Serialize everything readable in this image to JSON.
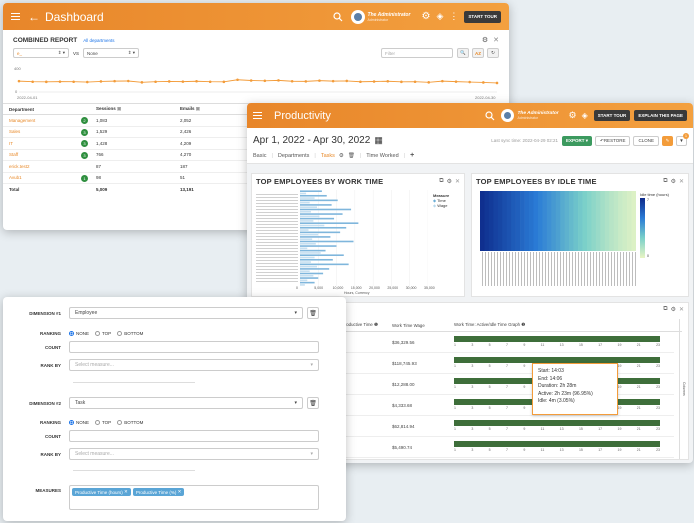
{
  "dashboard": {
    "title": "Dashboard",
    "start_tour": "START TOUR",
    "user_name": "The Administrator",
    "user_sub": "Administrator",
    "report_title": "COMBINED REPORT",
    "report_filter": "All departments",
    "metric_select": "e_",
    "vs_label": "VS",
    "compare_select": "None",
    "filter_placeholder": "Filter",
    "date_start": "2022-04-01",
    "date_end": "2022-04-30",
    "y_top": "400",
    "y_bottom": "0",
    "columns": [
      "Department",
      "Sessions",
      "Emails"
    ],
    "rows": [
      {
        "name": "Management",
        "badge": "2",
        "sessions": "1,083",
        "emails": "2,052"
      },
      {
        "name": "Sales",
        "badge": "3",
        "sessions": "1,529",
        "emails": "2,426"
      },
      {
        "name": "IT",
        "badge": "3",
        "sessions": "1,428",
        "emails": "4,209"
      },
      {
        "name": "Staff",
        "badge": "3",
        "sessions": "766",
        "emails": "4,270"
      },
      {
        "name": "erick.test2",
        "badge": "",
        "sessions": "87",
        "emails": "187"
      },
      {
        "name": "Avub1",
        "badge": "1",
        "sessions": "98",
        "emails": "51"
      }
    ],
    "total": {
      "name": "Total",
      "sessions": "5,009",
      "emails": "13,191"
    },
    "line_values": [
      160,
      150,
      148,
      152,
      150,
      145,
      155,
      160,
      162,
      140,
      150,
      155,
      152,
      158,
      150,
      148,
      182,
      170,
      165,
      172,
      158,
      156,
      168,
      160,
      163,
      150,
      154,
      158,
      148,
      150,
      140,
      160,
      152,
      145,
      138,
      130
    ]
  },
  "productivity": {
    "title": "Productivity",
    "user_name": "The Administrator",
    "user_sub": "Administrator",
    "start_tour": "START TOUR",
    "explain": "EXPLAIN THIS PAGE",
    "date_range": "Apr 1, 2022 - Apr 30, 2022",
    "sync": "Last sync time: 2022-04-29 02:21",
    "export": "EXPORT ▾",
    "restore": "RESTORE",
    "clone": "CLONE",
    "filter_badge": "1",
    "tabs": [
      "Basic",
      "Departments",
      "Tasks",
      "Time Worked"
    ],
    "card1_title": "TOP EMPLOYEES BY WORK TIME",
    "card2_title": "TOP EMPLOYEES BY IDLE TIME",
    "legend_title": "Measure",
    "legend": [
      "Time",
      "Wage"
    ],
    "x_ticks": [
      "0",
      "5,000",
      "10,000",
      "15,000",
      "20,000",
      "25,000",
      "30,000",
      "35,000"
    ],
    "x_axis_label": "Hours, Currency",
    "idle_legend": "Idle time (hours)",
    "idle_scale": [
      "7",
      "0"
    ],
    "work_bars": [
      0.18,
      0.05,
      0.22,
      0.12,
      0.31,
      0.08,
      0.26,
      0.14,
      0.42,
      0.09,
      0.35,
      0.16,
      0.28,
      0.11,
      0.48,
      0.2,
      0.38,
      0.07,
      0.33,
      0.15,
      0.25,
      0.1,
      0.44,
      0.13,
      0.3,
      0.06,
      0.21,
      0.17,
      0.36,
      0.12,
      0.27,
      0.09,
      0.4,
      0.14,
      0.24,
      0.08,
      0.19,
      0.11,
      0.15,
      0.06,
      0.12,
      0.04
    ],
    "idle_values": [
      0.98,
      0.95,
      0.93,
      0.9,
      0.88,
      0.85,
      0.83,
      0.8,
      0.78,
      0.75,
      0.72,
      0.7,
      0.67,
      0.64,
      0.61,
      0.58,
      0.55,
      0.52,
      0.48,
      0.45,
      0.42,
      0.39,
      0.36,
      0.33,
      0.3,
      0.27,
      0.24,
      0.21,
      0.18,
      0.15,
      0.13,
      0.1,
      0.08,
      0.06,
      0.04
    ],
    "table_cols": [
      "Productive Time",
      "Work Time Wage",
      "Work Time: Active/Idle Time Graph"
    ],
    "wages": [
      "$36,329.56",
      "$118,745.93",
      "$12,288.00",
      "$4,333.68",
      "$62,814.94",
      "$5,490.74"
    ],
    "partial": [
      "",
      "8",
      "4",
      "",
      "",
      ""
    ],
    "hour_ticks": [
      "1",
      "3",
      "5",
      "7",
      "9",
      "11",
      "13",
      "15",
      "17",
      "19",
      "21",
      "23"
    ],
    "columns_label": "Columns",
    "tooltip": [
      "Start: 14:03",
      "End: 14:06",
      "Duration: 2h 28m",
      "Active: 2h 23m (96.95%)",
      "Idle: 4m (3.05%)"
    ]
  },
  "dimensions": {
    "dim1_label": "DIMENSION #1",
    "dim1_value": "Employee",
    "dim2_label": "DIMENSION #2",
    "dim2_value": "Task",
    "ranking": "RANKING",
    "count": "COUNT",
    "rank_by": "RANK BY",
    "options": [
      "NONE",
      "TOP",
      "BOTTOM"
    ],
    "measure_placeholder": "Select measure...",
    "measures_label": "MEASURES",
    "measures": [
      "Productive Time (hours)",
      "Productive Time (%)"
    ]
  }
}
